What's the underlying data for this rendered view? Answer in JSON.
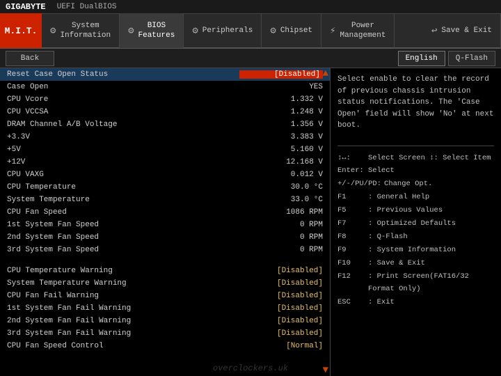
{
  "topbar": {
    "brand": "GIGABYTE",
    "product": "UEFI DualBIOS"
  },
  "nav": {
    "mit_label": "M.I.T.",
    "items": [
      {
        "id": "system-information",
        "icon": "⚙",
        "line1": "System",
        "line2": "Information"
      },
      {
        "id": "bios-features",
        "icon": "⚙",
        "line1": "BIOS",
        "line2": "Features"
      },
      {
        "id": "peripherals",
        "icon": "⚙",
        "line1": "Peripherals",
        "line2": ""
      },
      {
        "id": "chipset",
        "icon": "⚙",
        "line1": "Chipset",
        "line2": ""
      },
      {
        "id": "power-management",
        "icon": "⚡",
        "line1": "Power",
        "line2": "Management"
      },
      {
        "id": "save-exit",
        "icon": "↩",
        "line1": "Save & Exit",
        "line2": ""
      }
    ]
  },
  "subbar": {
    "back_label": "Back",
    "language_label": "English",
    "qflash_label": "Q-Flash"
  },
  "settings": [
    {
      "label": "Reset Case Open Status",
      "value": "[Disabled]",
      "type": "bracketed",
      "highlighted": true
    },
    {
      "label": "Case Open",
      "value": "YES",
      "type": "plain"
    },
    {
      "label": "CPU Vcore",
      "value": "1.332 V",
      "type": "plain"
    },
    {
      "label": "CPU VCCSA",
      "value": "1.248 V",
      "type": "plain"
    },
    {
      "label": "DRAM Channel A/B Voltage",
      "value": "1.356 V",
      "type": "plain"
    },
    {
      "label": "+3.3V",
      "value": "3.383 V",
      "type": "plain"
    },
    {
      "label": "+5V",
      "value": "5.160 V",
      "type": "plain"
    },
    {
      "label": "+12V",
      "value": "12.168 V",
      "type": "plain"
    },
    {
      "label": "CPU VAXG",
      "value": "0.012 V",
      "type": "plain"
    },
    {
      "label": "CPU Temperature",
      "value": "30.0 °C",
      "type": "plain"
    },
    {
      "label": "System Temperature",
      "value": "33.0 °C",
      "type": "plain"
    },
    {
      "label": "CPU Fan Speed",
      "value": "1086 RPM",
      "type": "plain"
    },
    {
      "label": "1st System Fan Speed",
      "value": "0 RPM",
      "type": "plain"
    },
    {
      "label": "2nd System Fan Speed",
      "value": "0 RPM",
      "type": "plain"
    },
    {
      "label": "3rd System Fan Speed",
      "value": "0 RPM",
      "type": "plain"
    },
    {
      "label": "SPACER",
      "value": "",
      "type": "spacer"
    },
    {
      "label": "CPU Temperature Warning",
      "value": "[Disabled]",
      "type": "bracketed"
    },
    {
      "label": "System Temperature Warning",
      "value": "[Disabled]",
      "type": "bracketed"
    },
    {
      "label": "CPU Fan Fail Warning",
      "value": "[Disabled]",
      "type": "bracketed"
    },
    {
      "label": "1st System Fan Fail Warning",
      "value": "[Disabled]",
      "type": "bracketed"
    },
    {
      "label": "2nd System Fan Fail Warning",
      "value": "[Disabled]",
      "type": "bracketed"
    },
    {
      "label": "3rd System Fan Fail Warning",
      "value": "[Disabled]",
      "type": "bracketed"
    },
    {
      "label": "CPU Fan Speed Control",
      "value": "[Normal]",
      "type": "bracketed"
    }
  ],
  "help": {
    "description": "Select enable to clear the record of previous chassis intrusion status notifications. The 'Case Open' field will show 'No' at next boot."
  },
  "shortcuts": [
    {
      "key": "↕↔:",
      "desc": "Select Screen  ↕: Select Item"
    },
    {
      "key": "Enter:",
      "desc": "Select"
    },
    {
      "key": "+/-/PU/PD:",
      "desc": "Change Opt."
    },
    {
      "key": "F1",
      "desc": ": General Help"
    },
    {
      "key": "F5",
      "desc": ": Previous Values"
    },
    {
      "key": "F7",
      "desc": ": Optimized Defaults"
    },
    {
      "key": "F8",
      "desc": ": Q-Flash"
    },
    {
      "key": "F9",
      "desc": ": System Information"
    },
    {
      "key": "F10",
      "desc": ": Save & Exit"
    },
    {
      "key": "F12",
      "desc": ": Print Screen(FAT16/32 Format Only)"
    },
    {
      "key": "ESC",
      "desc": ": Exit"
    }
  ],
  "watermark": "overclockers.uk"
}
